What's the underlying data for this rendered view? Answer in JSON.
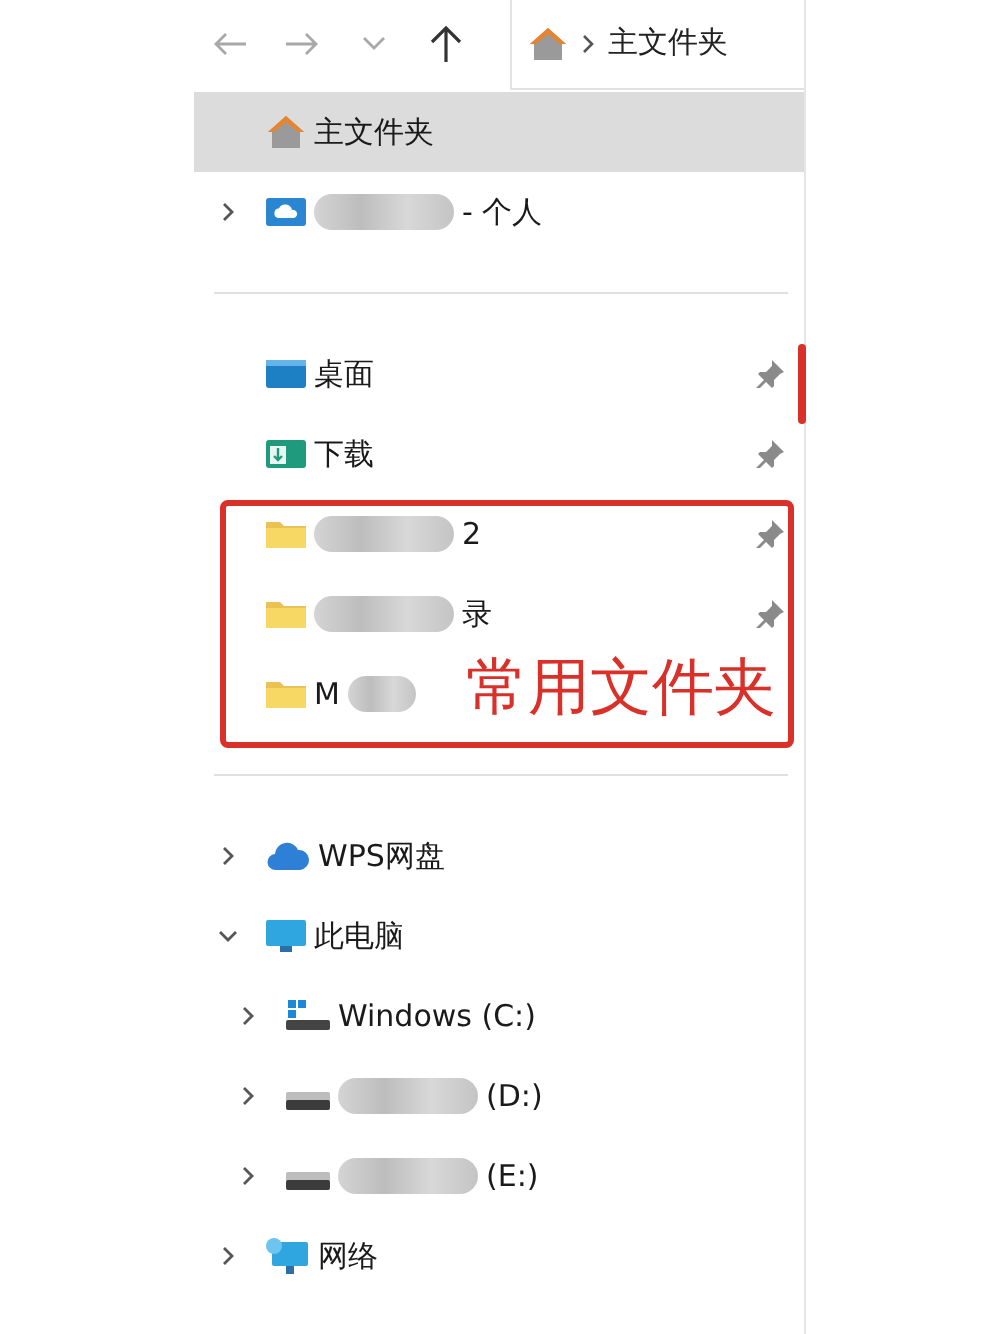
{
  "toolbar": {
    "buttons": [
      {
        "kind": "back",
        "disabled": true
      },
      {
        "kind": "forward",
        "disabled": true
      },
      {
        "kind": "recent",
        "disabled": true
      },
      {
        "kind": "up",
        "disabled": false
      }
    ]
  },
  "address": {
    "crumbs": [
      "主文件夹"
    ]
  },
  "tree": [
    {
      "items": [
        {
          "label": "主文件夹",
          "kind": "home",
          "selected": true,
          "pinned": false,
          "blur_before": false,
          "blur_after": false
        },
        {
          "label": "- 个人",
          "kind": "cloud-folder",
          "expanded": false,
          "selected": false,
          "pinned": false,
          "blur_before": true,
          "blur_after": false
        }
      ]
    },
    {
      "items": [
        {
          "label": "桌面",
          "kind": "desktop-folder",
          "selected": false,
          "pinned": true,
          "blur_before": false,
          "blur_after": false
        },
        {
          "label": "下载",
          "kind": "download-folder",
          "selected": false,
          "pinned": true,
          "blur_before": false,
          "blur_after": false
        },
        {
          "label": "2",
          "kind": "folder",
          "selected": false,
          "pinned": true,
          "blur_before": true,
          "blur_after": false
        },
        {
          "label": "录",
          "kind": "folder",
          "selected": false,
          "pinned": true,
          "blur_before": true,
          "blur_after": false
        },
        {
          "label": "M",
          "kind": "folder",
          "selected": false,
          "pinned": false,
          "blur_before": false,
          "blur_after": true
        }
      ]
    },
    {
      "items": [
        {
          "label": "WPS网盘",
          "kind": "cloud",
          "expanded": false,
          "selected": false,
          "pinned": false,
          "blur_before": false,
          "blur_after": false
        },
        {
          "label": "此电脑",
          "kind": "monitor",
          "expanded": true,
          "selected": false,
          "pinned": false,
          "blur_before": false,
          "blur_after": false,
          "children": [
            {
              "label": "Windows (C:)",
              "kind": "system-drive",
              "expanded": false,
              "selected": false,
              "pinned": false,
              "blur_before": false,
              "blur_after": false
            },
            {
              "label": "(D:)",
              "kind": "drive",
              "expanded": false,
              "selected": false,
              "pinned": false,
              "blur_before": true,
              "blur_after": false
            },
            {
              "label": "(E:)",
              "kind": "drive",
              "expanded": false,
              "selected": false,
              "pinned": false,
              "blur_before": true,
              "blur_after": false
            }
          ]
        },
        {
          "label": "网络",
          "kind": "network",
          "expanded": false,
          "selected": false,
          "pinned": false,
          "blur_before": false,
          "blur_after": false
        }
      ]
    }
  ],
  "annotation": {
    "text": "常用文件夹"
  }
}
